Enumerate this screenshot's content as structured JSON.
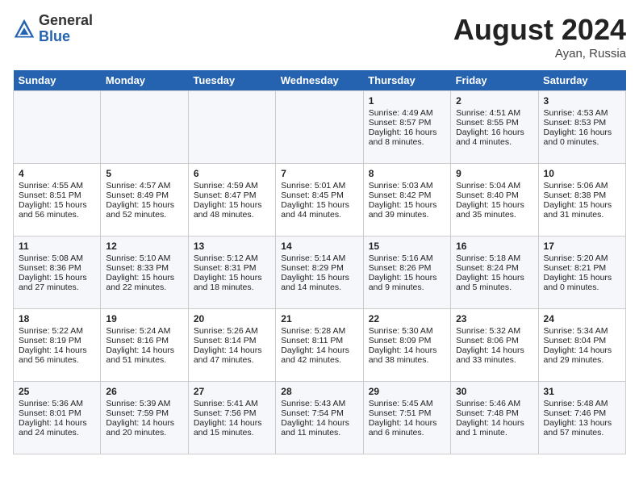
{
  "header": {
    "logo_general": "General",
    "logo_blue": "Blue",
    "month_title": "August 2024",
    "location": "Ayan, Russia"
  },
  "days_of_week": [
    "Sunday",
    "Monday",
    "Tuesday",
    "Wednesday",
    "Thursday",
    "Friday",
    "Saturday"
  ],
  "weeks": [
    [
      {
        "day": "",
        "info": ""
      },
      {
        "day": "",
        "info": ""
      },
      {
        "day": "",
        "info": ""
      },
      {
        "day": "",
        "info": ""
      },
      {
        "day": "1",
        "info": "Sunrise: 4:49 AM\nSunset: 8:57 PM\nDaylight: 16 hours\nand 8 minutes."
      },
      {
        "day": "2",
        "info": "Sunrise: 4:51 AM\nSunset: 8:55 PM\nDaylight: 16 hours\nand 4 minutes."
      },
      {
        "day": "3",
        "info": "Sunrise: 4:53 AM\nSunset: 8:53 PM\nDaylight: 16 hours\nand 0 minutes."
      }
    ],
    [
      {
        "day": "4",
        "info": "Sunrise: 4:55 AM\nSunset: 8:51 PM\nDaylight: 15 hours\nand 56 minutes."
      },
      {
        "day": "5",
        "info": "Sunrise: 4:57 AM\nSunset: 8:49 PM\nDaylight: 15 hours\nand 52 minutes."
      },
      {
        "day": "6",
        "info": "Sunrise: 4:59 AM\nSunset: 8:47 PM\nDaylight: 15 hours\nand 48 minutes."
      },
      {
        "day": "7",
        "info": "Sunrise: 5:01 AM\nSunset: 8:45 PM\nDaylight: 15 hours\nand 44 minutes."
      },
      {
        "day": "8",
        "info": "Sunrise: 5:03 AM\nSunset: 8:42 PM\nDaylight: 15 hours\nand 39 minutes."
      },
      {
        "day": "9",
        "info": "Sunrise: 5:04 AM\nSunset: 8:40 PM\nDaylight: 15 hours\nand 35 minutes."
      },
      {
        "day": "10",
        "info": "Sunrise: 5:06 AM\nSunset: 8:38 PM\nDaylight: 15 hours\nand 31 minutes."
      }
    ],
    [
      {
        "day": "11",
        "info": "Sunrise: 5:08 AM\nSunset: 8:36 PM\nDaylight: 15 hours\nand 27 minutes."
      },
      {
        "day": "12",
        "info": "Sunrise: 5:10 AM\nSunset: 8:33 PM\nDaylight: 15 hours\nand 22 minutes."
      },
      {
        "day": "13",
        "info": "Sunrise: 5:12 AM\nSunset: 8:31 PM\nDaylight: 15 hours\nand 18 minutes."
      },
      {
        "day": "14",
        "info": "Sunrise: 5:14 AM\nSunset: 8:29 PM\nDaylight: 15 hours\nand 14 minutes."
      },
      {
        "day": "15",
        "info": "Sunrise: 5:16 AM\nSunset: 8:26 PM\nDaylight: 15 hours\nand 9 minutes."
      },
      {
        "day": "16",
        "info": "Sunrise: 5:18 AM\nSunset: 8:24 PM\nDaylight: 15 hours\nand 5 minutes."
      },
      {
        "day": "17",
        "info": "Sunrise: 5:20 AM\nSunset: 8:21 PM\nDaylight: 15 hours\nand 0 minutes."
      }
    ],
    [
      {
        "day": "18",
        "info": "Sunrise: 5:22 AM\nSunset: 8:19 PM\nDaylight: 14 hours\nand 56 minutes."
      },
      {
        "day": "19",
        "info": "Sunrise: 5:24 AM\nSunset: 8:16 PM\nDaylight: 14 hours\nand 51 minutes."
      },
      {
        "day": "20",
        "info": "Sunrise: 5:26 AM\nSunset: 8:14 PM\nDaylight: 14 hours\nand 47 minutes."
      },
      {
        "day": "21",
        "info": "Sunrise: 5:28 AM\nSunset: 8:11 PM\nDaylight: 14 hours\nand 42 minutes."
      },
      {
        "day": "22",
        "info": "Sunrise: 5:30 AM\nSunset: 8:09 PM\nDaylight: 14 hours\nand 38 minutes."
      },
      {
        "day": "23",
        "info": "Sunrise: 5:32 AM\nSunset: 8:06 PM\nDaylight: 14 hours\nand 33 minutes."
      },
      {
        "day": "24",
        "info": "Sunrise: 5:34 AM\nSunset: 8:04 PM\nDaylight: 14 hours\nand 29 minutes."
      }
    ],
    [
      {
        "day": "25",
        "info": "Sunrise: 5:36 AM\nSunset: 8:01 PM\nDaylight: 14 hours\nand 24 minutes."
      },
      {
        "day": "26",
        "info": "Sunrise: 5:39 AM\nSunset: 7:59 PM\nDaylight: 14 hours\nand 20 minutes."
      },
      {
        "day": "27",
        "info": "Sunrise: 5:41 AM\nSunset: 7:56 PM\nDaylight: 14 hours\nand 15 minutes."
      },
      {
        "day": "28",
        "info": "Sunrise: 5:43 AM\nSunset: 7:54 PM\nDaylight: 14 hours\nand 11 minutes."
      },
      {
        "day": "29",
        "info": "Sunrise: 5:45 AM\nSunset: 7:51 PM\nDaylight: 14 hours\nand 6 minutes."
      },
      {
        "day": "30",
        "info": "Sunrise: 5:46 AM\nSunset: 7:48 PM\nDaylight: 14 hours\nand 1 minute."
      },
      {
        "day": "31",
        "info": "Sunrise: 5:48 AM\nSunset: 7:46 PM\nDaylight: 13 hours\nand 57 minutes."
      }
    ]
  ]
}
